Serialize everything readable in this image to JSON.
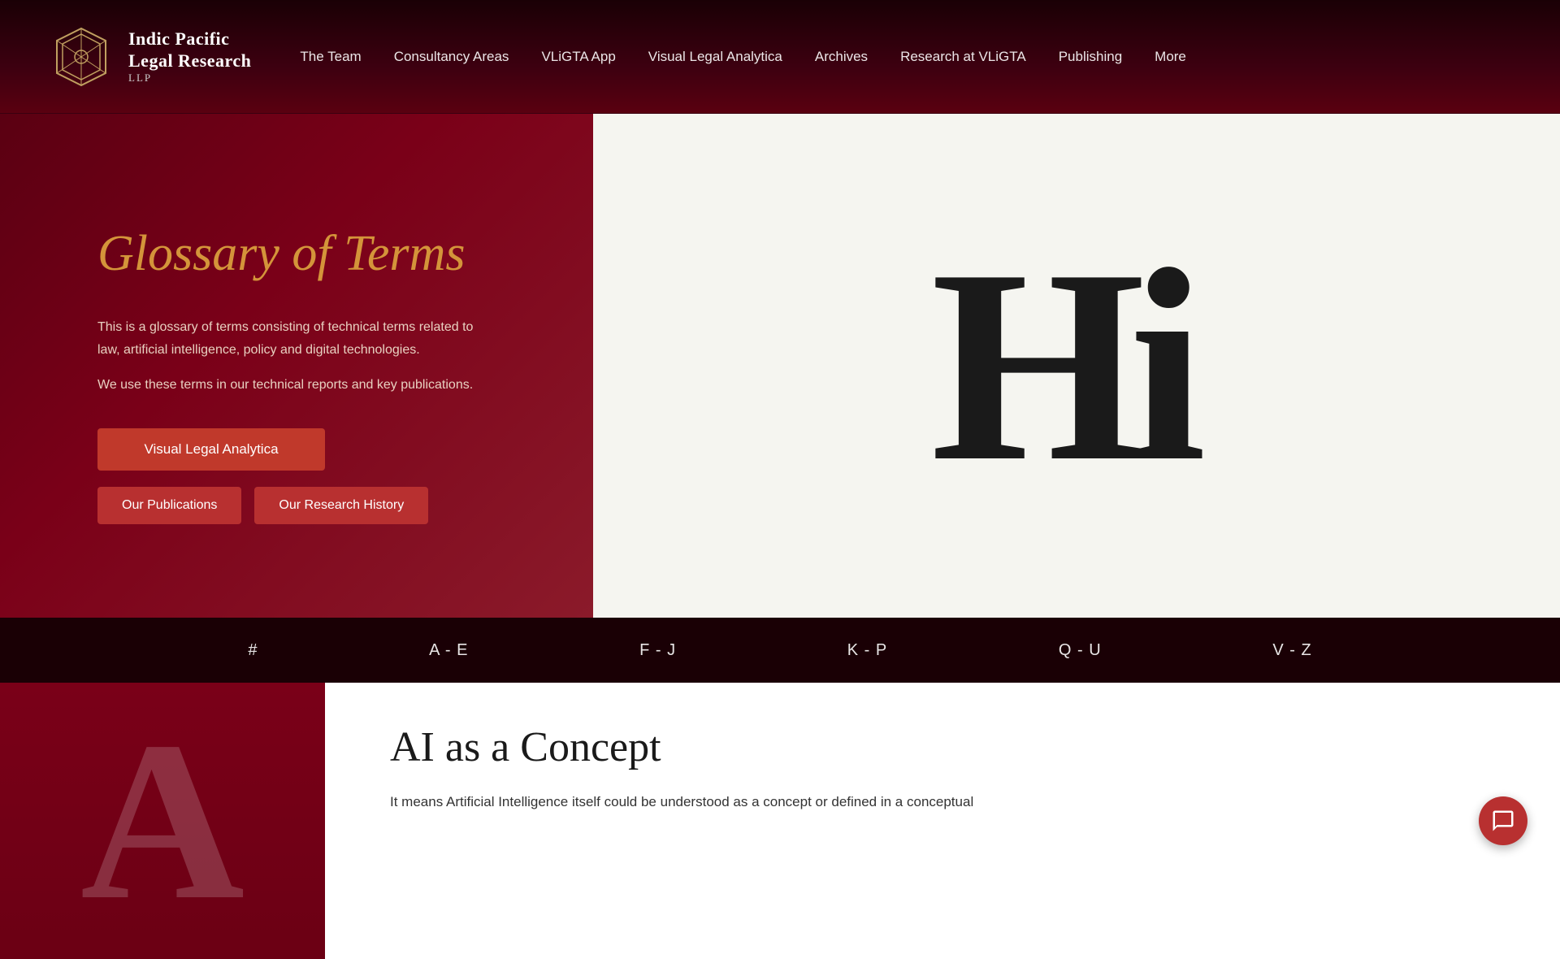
{
  "brand": {
    "name": "Indic Pacific\nLegal Research",
    "llp": "LLP",
    "logo_alt": "Indic Pacific Legal Research Logo"
  },
  "nav": {
    "items": [
      {
        "label": "The Team",
        "href": "#"
      },
      {
        "label": "Consultancy Areas",
        "href": "#"
      },
      {
        "label": "VLiGTA App",
        "href": "#"
      },
      {
        "label": "Visual Legal Analytica",
        "href": "#"
      },
      {
        "label": "Archives",
        "href": "#"
      },
      {
        "label": "Research at VLiGTA",
        "href": "#"
      },
      {
        "label": "Publishing",
        "href": "#"
      },
      {
        "label": "More",
        "href": "#"
      }
    ]
  },
  "hero": {
    "title": "Glossary of Terms",
    "description1": "This is a glossary of terms consisting of technical terms related to law, artificial intelligence, policy and digital technologies.",
    "description2": "We use these terms in our technical reports and key publications.",
    "btn_primary": "Visual Legal Analytica",
    "btn_secondary1": "Our Publications",
    "btn_secondary2": "Our Research History",
    "image_text": "Hi"
  },
  "glossary_nav": {
    "items": [
      "#",
      "A - E",
      "F - J",
      "K - P",
      "Q - U",
      "V - Z"
    ]
  },
  "content": {
    "big_letter": "A",
    "title": "AI as a Concept",
    "text": "It means Artificial Intelligence itself could be understood as a concept or defined in a conceptual"
  },
  "colors": {
    "accent": "#d4943a",
    "dark_bg": "#1a0005",
    "hero_bg": "#7a0018",
    "btn_red": "#c0392b",
    "white": "#ffffff"
  }
}
